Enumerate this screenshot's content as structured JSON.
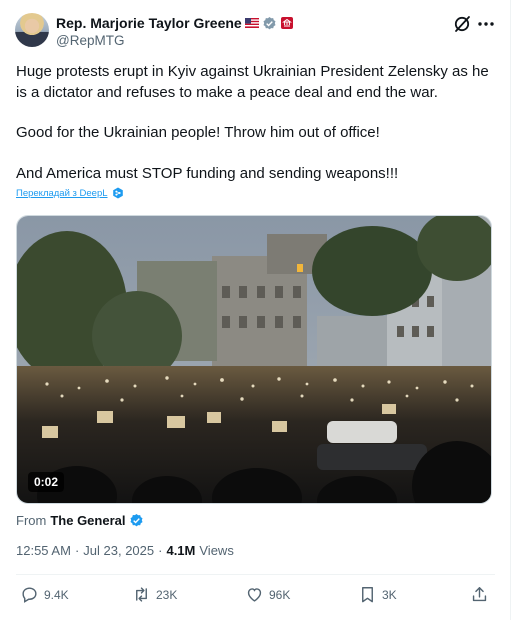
{
  "author": {
    "display_name": "Rep. Marjorie Taylor Greene",
    "handle": "@RepMTG"
  },
  "tweet": {
    "paragraphs": [
      "Huge protests erupt in Kyiv against Ukrainian President Zelensky as he is a dictator and refuses to make a peace deal and end the war.",
      "Good for the Ukrainian people! Throw him out of office!",
      "And America must STOP funding and sending weapons!!!"
    ],
    "translate_label": "Перекладай з DeepL"
  },
  "media": {
    "duration": "0:02"
  },
  "source": {
    "prefix": "From",
    "name": "The General"
  },
  "meta": {
    "time": "12:55 AM",
    "separator": "·",
    "date": "Jul 23, 2025",
    "views_count": "4.1M",
    "views_label": "Views"
  },
  "actions": {
    "replies": "9.4K",
    "reposts": "23K",
    "likes": "96K",
    "bookmarks": "3K"
  },
  "colors": {
    "accent": "#1d9bf0",
    "text": "#0f1419",
    "muted": "#536471",
    "verified_gray": "#829aab"
  }
}
